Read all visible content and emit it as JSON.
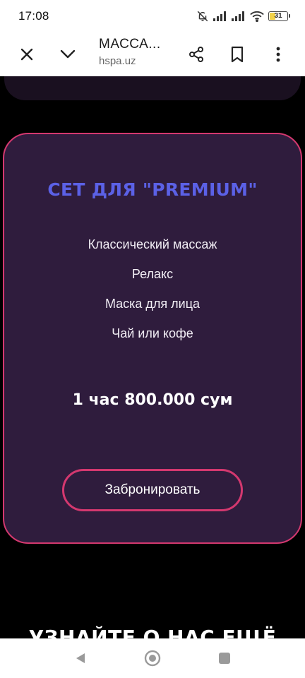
{
  "status_bar": {
    "time": "17:08",
    "battery": "31",
    "battery_fraction": 0.31
  },
  "toolbar": {
    "title": "МАССА...",
    "url": "hspa.uz"
  },
  "card": {
    "title": "СЕТ ДЛЯ \"PREMIUM\"",
    "features": [
      "Классический массаж",
      "Релакс",
      "Маска для лица",
      "Чай или кофе"
    ],
    "price": "1 час 800.000 сум",
    "button_label": "Забронировать"
  },
  "next_section": {
    "heading": "УЗНАЙТЕ О НАС ЕЩЁ"
  },
  "colors": {
    "accent_border": "#d4386f",
    "title_color": "#5b61e6",
    "card_bg": "#2f1c3d",
    "page_bg": "#000000"
  }
}
